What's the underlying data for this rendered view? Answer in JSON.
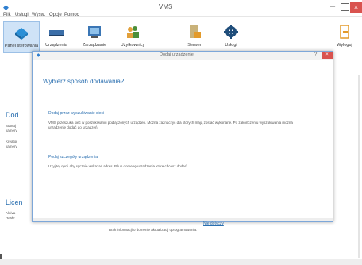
{
  "window": {
    "title": "VMS",
    "close": "×"
  },
  "menu": [
    "Plik",
    "Usługi",
    "Wyśw.",
    "Opcje",
    "Pomoc"
  ],
  "toolbar": {
    "items": [
      {
        "label": "Panel sterowania",
        "icon": "book-icon",
        "active": true
      },
      {
        "label": "Urządzenia",
        "icon": "dvr-icon"
      },
      {
        "label": "Zarządzanie",
        "icon": "monitor-icon"
      },
      {
        "label": "Użytkownicy",
        "icon": "users-icon"
      },
      {
        "label": "Serwer",
        "icon": "server-icon"
      },
      {
        "label": "Usługi",
        "icon": "gear-icon"
      }
    ],
    "logout_label": "Wyloguj"
  },
  "background": {
    "section1_heading": "Dod",
    "section1_lines": [
      "Startuj",
      "kamery"
    ],
    "section1_lines2": [
      "Kreator",
      "kamery"
    ],
    "section2_heading": "Licen",
    "section2_lines": [
      "Aktiva",
      "Hasłe"
    ]
  },
  "modal": {
    "title": "Dodaj urządzenie",
    "help": "?",
    "close": "×",
    "heading": "Wybierz sposób dodawania?",
    "option1_title": "Dodaj przez wyszukiwanie sieci",
    "option1_text": "VMS przeszuka sieć w poszukiwaniu podłączonych urządzeń. Można zaznaczyć dla których mają zostać wykonane. Po zakończeniu wyszukiwania można urządzenie dodać do urządzeń.",
    "option2_title": "Podaj szczegóły urządzenia",
    "option2_text": "Użyj tej opcji aby ręcznie wskazać adres IP lub domenę urządzenia które chcesz dodać."
  },
  "bottom": {
    "link": "Nie dotyczy",
    "info": "Brak informacji o domenie aktualizacji oprogramowania."
  },
  "colors": {
    "accent": "#2a6fb0",
    "close": "#d9534f",
    "active_tab": "#cfe3f7"
  }
}
